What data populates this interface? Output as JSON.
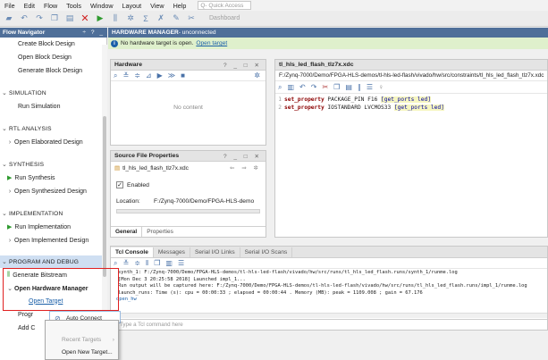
{
  "menu": [
    "File",
    "Edit",
    "Flow",
    "Tools",
    "Window",
    "Layout",
    "View",
    "Help"
  ],
  "quick_access": "Q- Quick Access",
  "toolbar": {
    "dashboard": "Dashboard"
  },
  "flow_navigator": {
    "title": "Flow Navigator",
    "controls": "÷ ? _",
    "items": [
      {
        "label": "Create Block Design",
        "kind": "item"
      },
      {
        "label": "Open Block Design",
        "kind": "item"
      },
      {
        "label": "Generate Block Design",
        "kind": "item"
      },
      {
        "label": "SIMULATION",
        "kind": "section"
      },
      {
        "label": "Run Simulation",
        "kind": "item"
      },
      {
        "label": "RTL ANALYSIS",
        "kind": "section"
      },
      {
        "label": "Open Elaborated Design",
        "kind": "sub"
      },
      {
        "label": "SYNTHESIS",
        "kind": "section"
      },
      {
        "label": "Run Synthesis",
        "kind": "run"
      },
      {
        "label": "Open Synthesized Design",
        "kind": "sub"
      },
      {
        "label": "IMPLEMENTATION",
        "kind": "section"
      },
      {
        "label": "Run Implementation",
        "kind": "run"
      },
      {
        "label": "Open Implemented Design",
        "kind": "sub"
      },
      {
        "label": "PROGRAM AND DEBUG",
        "kind": "section"
      },
      {
        "label": "Generate Bitstream",
        "kind": "bit"
      },
      {
        "label": "Open Hardware Manager",
        "kind": "open"
      },
      {
        "label": "Open Target",
        "kind": "link"
      },
      {
        "label": "Progr",
        "kind": "item"
      },
      {
        "label": "Add C",
        "kind": "item"
      }
    ]
  },
  "hardware_manager": {
    "title": "HARDWARE MANAGER",
    "status": " - unconnected",
    "info": "No hardware target is open.",
    "info_link": "Open target"
  },
  "hardware_pane": {
    "title": "Hardware",
    "controls": "? _ □ ✕",
    "empty": "No content"
  },
  "source_props": {
    "title": "Source File Properties",
    "controls": "? _ □ ✕",
    "file": "tl_hls_led_flash_tlz7x.xdc",
    "enabled": "Enabled",
    "location_label": "Location:",
    "location_value": "F:/Zynq-7000/Demo/FPGA-HLS-demo",
    "tabs": [
      "General",
      "Properties"
    ]
  },
  "editor": {
    "title": "tl_hls_led_flash_tlz7x.xdc",
    "path": "F:/Zynq-7000/Demo/FPGA-HLS-demos/tl-hls-led-flash/vivado/hw/src/constraints/tl_hls_led_flash_tlz7x.xdc",
    "lines": [
      {
        "n": "1",
        "cmd": "set_property",
        "rest": " PACKAGE_PIN F16 ",
        "br": "[get_ports led]"
      },
      {
        "n": "2",
        "cmd": "set_property",
        "rest": " IOSTANDARD LVCMOS33 ",
        "br": "[get_ports led]"
      }
    ]
  },
  "console": {
    "tabs": [
      "Tcl Console",
      "Messages",
      "Serial I/O Links",
      "Serial I/O Scans"
    ],
    "lines": [
      "synth_1: F:/Zynq-7000/Demo/FPGA-HLS-demos/tl-hls-led-flash/vivado/hw/src/runs/tl_hls_led_flash.runs/synth_1/runme.log",
      "[Mon Dec  3 20:25:58 2018] Launched impl_1...",
      "Run output will be captured here: F:/Zynq-7000/Demo/FPGA-HLS-demos/tl-hls-led-flash/vivado/hw/src/runs/tl_hls_led_flash.runs/impl_1/runme.log",
      "launch_runs: Time (s): cpu = 00:00:33 ; elapsed = 00:00:44 . Memory (MB): peak = 1109.008 ; gain = 67.176",
      "open_hw"
    ],
    "input_placeholder": "Type a Tcl command here"
  },
  "context_menu": {
    "highlight": "Auto Connect",
    "items": [
      "Recent Targets",
      "Open New Target..."
    ]
  }
}
